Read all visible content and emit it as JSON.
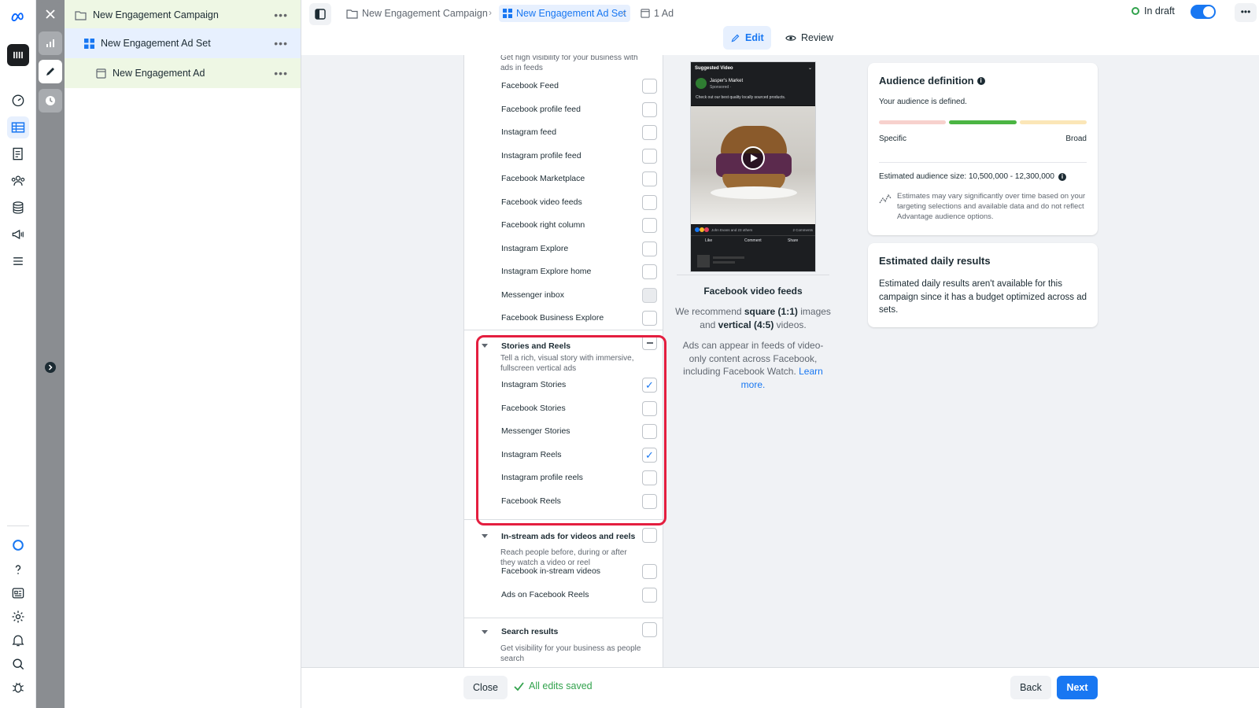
{
  "tree": {
    "campaign": "New Engagement Campaign",
    "ad_set": "New Engagement Ad Set",
    "ad": "New Engagement Ad",
    "more": "•••"
  },
  "breadcrumb": {
    "campaign": "New Engagement Campaign",
    "ad_set": "New Engagement Ad Set",
    "ad": "1 Ad"
  },
  "status": {
    "label": "In draft",
    "toggle_on": true,
    "more": "•••"
  },
  "modes": {
    "edit": "Edit",
    "review": "Review"
  },
  "placements": {
    "feeds_desc": "Get high visibility for your business with ads in feeds",
    "feeds": [
      {
        "label": "Facebook Feed",
        "checked": false
      },
      {
        "label": "Facebook profile feed",
        "checked": false
      },
      {
        "label": "Instagram feed",
        "checked": false
      },
      {
        "label": "Instagram profile feed",
        "checked": false
      },
      {
        "label": "Facebook Marketplace",
        "checked": false
      },
      {
        "label": "Facebook video feeds",
        "checked": false
      },
      {
        "label": "Facebook right column",
        "checked": false
      },
      {
        "label": "Instagram Explore",
        "checked": false
      },
      {
        "label": "Instagram Explore home",
        "checked": false
      },
      {
        "label": "Messenger inbox",
        "checked": false,
        "disabled": true
      },
      {
        "label": "Facebook Business Explore",
        "checked": false
      }
    ],
    "stories": {
      "title": "Stories and Reels",
      "desc": "Tell a rich, visual story with immersive, fullscreen vertical ads",
      "items": [
        {
          "label": "Instagram Stories",
          "checked": true
        },
        {
          "label": "Facebook Stories",
          "checked": false
        },
        {
          "label": "Messenger Stories",
          "checked": false
        },
        {
          "label": "Instagram Reels",
          "checked": true
        },
        {
          "label": "Instagram profile reels",
          "checked": false
        },
        {
          "label": "Facebook Reels",
          "checked": false
        }
      ]
    },
    "instream": {
      "title": "In-stream ads for videos and reels",
      "desc": "Reach people before, during or after they watch a video or reel",
      "items": [
        {
          "label": "Facebook in-stream videos",
          "checked": false
        },
        {
          "label": "Ads on Facebook Reels",
          "checked": false
        }
      ]
    },
    "search": {
      "title": "Search results",
      "desc": "Get visibility for your business as people search"
    }
  },
  "preview": {
    "header": "Suggested Video",
    "page_name": "Jasper's Market",
    "sponsored": "Sponsored · ",
    "caption": "Check out our best quality locally sourced products.",
    "reactions": "John Evans and 23 others",
    "comments": "2 Comments",
    "like": "Like",
    "comment": "Comment",
    "share": "Share",
    "title": "Facebook video feeds",
    "rec_1": "We recommend ",
    "rec_square": "square (1:1)",
    "rec_2": " images and ",
    "rec_vertical": "vertical (4:5)",
    "rec_3": " videos.",
    "desc": "Ads can appear in feeds of video-only content across Facebook, including Facebook Watch. ",
    "learn_more": "Learn more."
  },
  "audience": {
    "title": "Audience definition",
    "status": "Your audience is defined.",
    "specific": "Specific",
    "broad": "Broad",
    "size_label": "Estimated audience size: 10,500,000 - 12,300,000",
    "note": "Estimates may vary significantly over time based on your targeting selections and available data and do not reflect Advantage audience options."
  },
  "daily": {
    "title": "Estimated daily results",
    "text": "Estimated daily results aren't available for this campaign since it has a budget optimized across ad sets."
  },
  "footer": {
    "close": "Close",
    "saved": "All edits saved",
    "back": "Back",
    "next": "Next"
  },
  "colors": {
    "accent": "#1877f2",
    "highlight": "#e41e3f",
    "saved_green": "#31a24c"
  }
}
